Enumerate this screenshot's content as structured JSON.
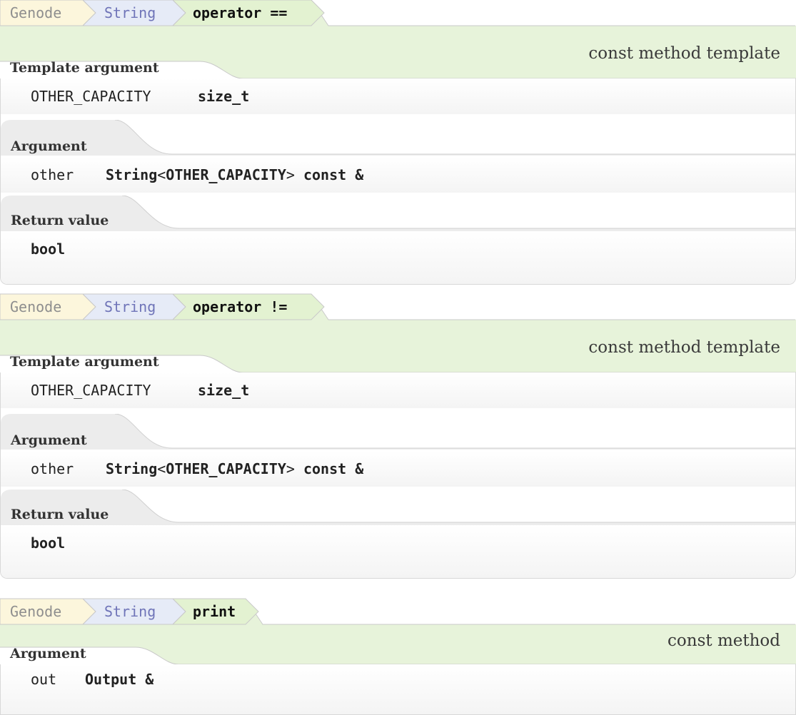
{
  "blocks": [
    {
      "breadcrumb": {
        "namespace": "Genode",
        "class": "String",
        "member": "operator =="
      },
      "kind": "const method template",
      "template_section": {
        "heading": "Template argument",
        "name": "OTHER_CAPACITY",
        "type": "size_t"
      },
      "argument_section": {
        "heading": "Argument",
        "name": "other",
        "type_class": "String",
        "type_open": "<",
        "type_param": "OTHER_CAPACITY",
        "type_close": ">",
        "type_suffix": "const &"
      },
      "return_section": {
        "heading": "Return value",
        "type": "bool"
      }
    },
    {
      "breadcrumb": {
        "namespace": "Genode",
        "class": "String",
        "member": "operator !="
      },
      "kind": "const method template",
      "template_section": {
        "heading": "Template argument",
        "name": "OTHER_CAPACITY",
        "type": "size_t"
      },
      "argument_section": {
        "heading": "Argument",
        "name": "other",
        "type_class": "String",
        "type_open": "<",
        "type_param": "OTHER_CAPACITY",
        "type_close": ">",
        "type_suffix": "const &"
      },
      "return_section": {
        "heading": "Return value",
        "type": "bool"
      }
    },
    {
      "breadcrumb": {
        "namespace": "Genode",
        "class": "String",
        "member": "print"
      },
      "kind": "const method",
      "argument_section": {
        "heading": "Argument",
        "name": "out",
        "type": "Output &"
      }
    }
  ],
  "colors": {
    "namespace_fill": "#fcf6dc",
    "class_fill": "#e6ebf7",
    "member_fill": "#e3f2d1",
    "header_fill": "#e7f3da",
    "border": "#c8c8c8"
  }
}
